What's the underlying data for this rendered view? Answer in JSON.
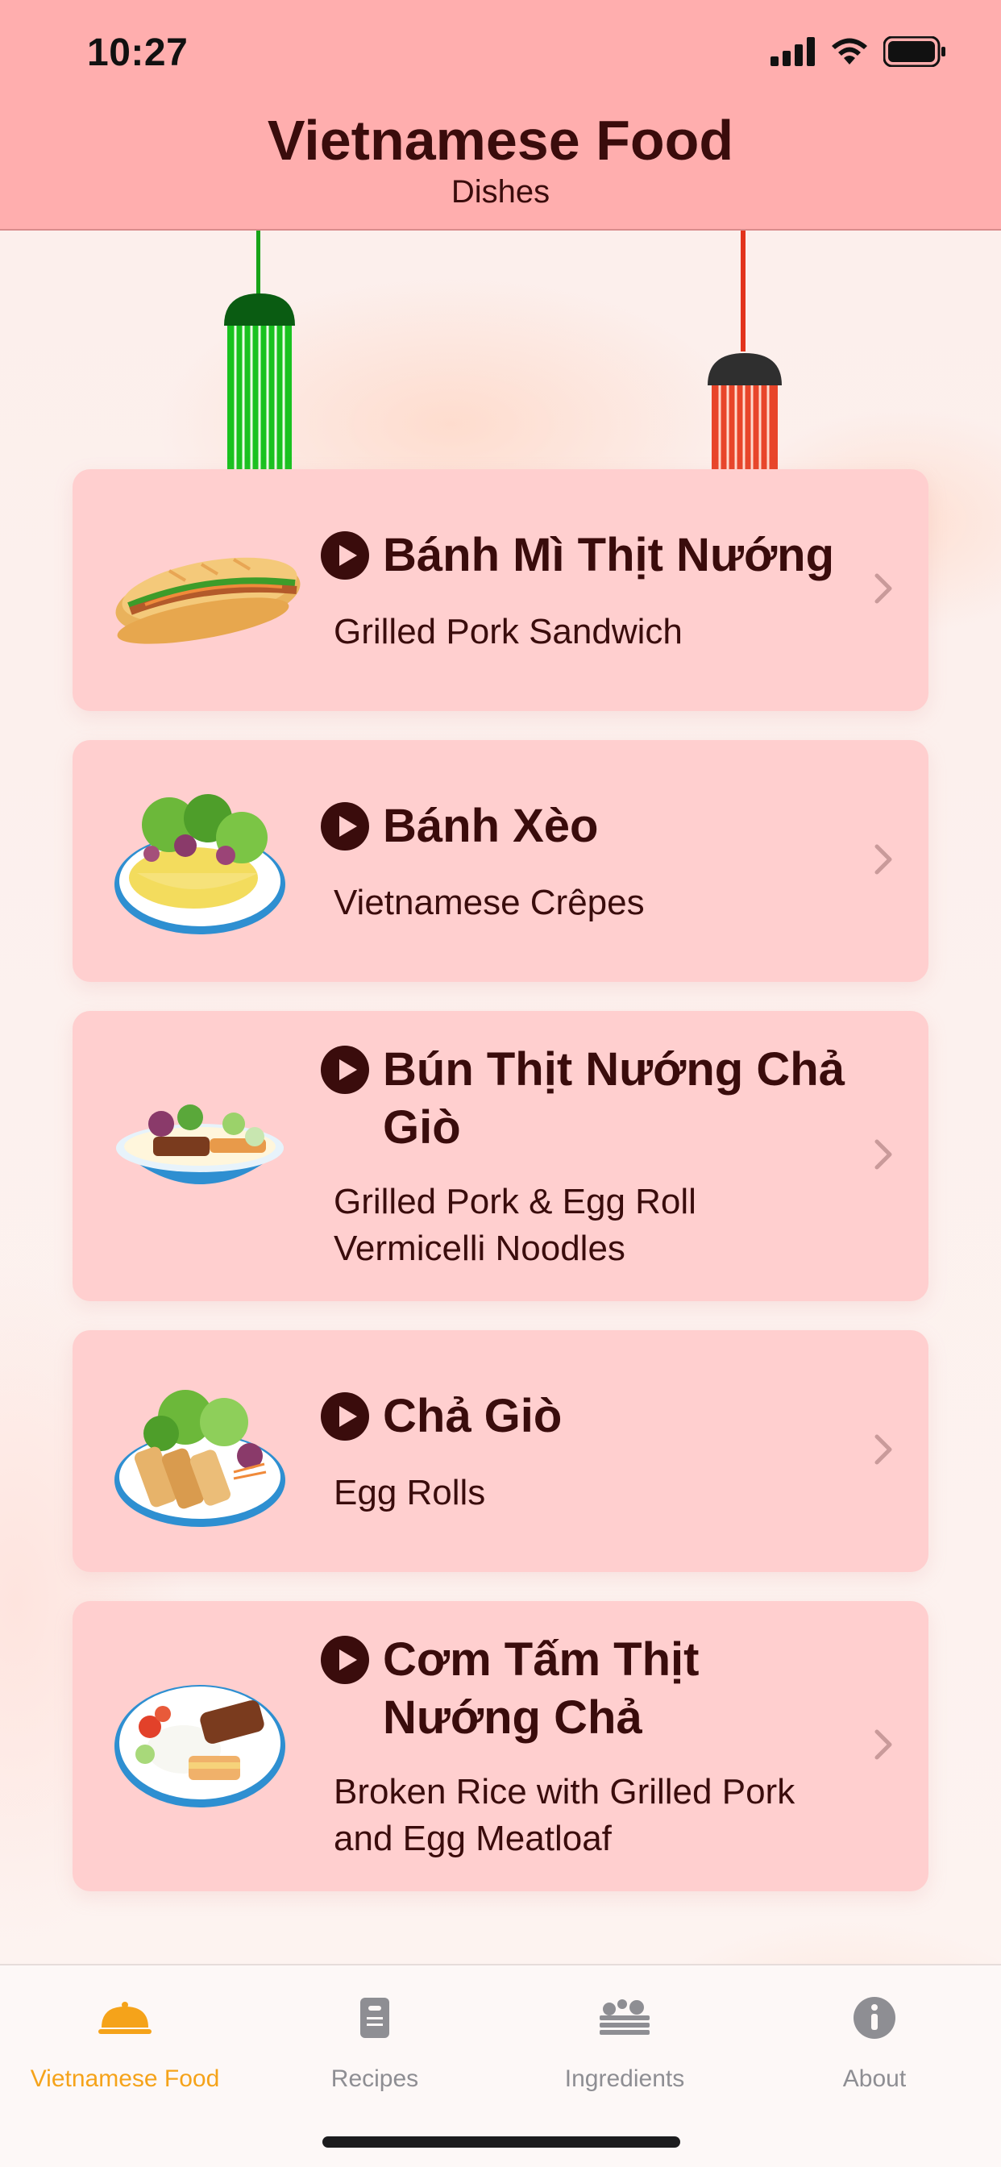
{
  "status_bar": {
    "time": "10:27"
  },
  "header": {
    "title": "Vietnamese Food",
    "subtitle": "Dishes"
  },
  "dishes": [
    {
      "name": "Bánh Mì Thịt Nướng",
      "description": "Grilled Pork Sandwich",
      "image": "banh-mi-image"
    },
    {
      "name": "Bánh Xèo",
      "description": "Vietnamese Crêpes",
      "image": "banh-xeo-image"
    },
    {
      "name": "Bún Thịt Nướng Chả Giò",
      "description": "Grilled Pork & Egg Roll Vermicelli Noodles",
      "image": "bun-thit-nuong-image"
    },
    {
      "name": "Chả Giò",
      "description": "Egg Rolls",
      "image": "cha-gio-image"
    },
    {
      "name": "Cơm Tấm Thịt Nướng Chả",
      "description": "Broken Rice with Grilled Pork and Egg Meatloaf",
      "image": "com-tam-image"
    }
  ],
  "tabs": [
    {
      "label": "Vietnamese Food",
      "icon": "food-cloche-icon",
      "active": true
    },
    {
      "label": "Recipes",
      "icon": "recipe-card-icon",
      "active": false
    },
    {
      "label": "Ingredients",
      "icon": "ingredients-icon",
      "active": false
    },
    {
      "label": "About",
      "icon": "info-icon",
      "active": false
    }
  ],
  "colors": {
    "header_bg": "#ffaeae",
    "card_bg": "#ffcfcf",
    "text_dark": "#3a0c0c",
    "tab_active": "#f5a31a",
    "tab_inactive": "#8e8e93"
  }
}
